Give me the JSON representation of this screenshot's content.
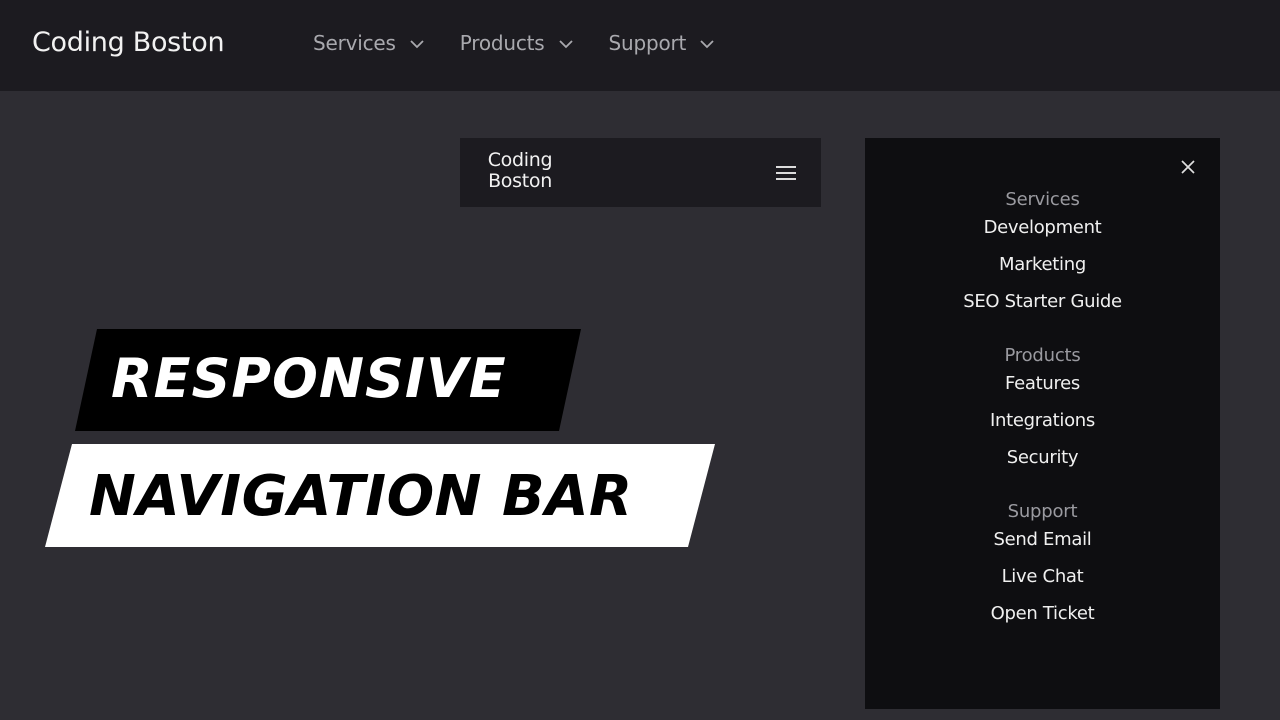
{
  "topbar": {
    "logo": "Coding Boston",
    "menu": [
      {
        "label": "Services",
        "icon": "chevron-down-icon"
      },
      {
        "label": "Products",
        "icon": "chevron-down-icon"
      },
      {
        "label": "Support",
        "icon": "chevron-down-icon"
      }
    ]
  },
  "mobile_bar": {
    "logo_line1": "Coding",
    "logo_line2": "Boston",
    "menu_icon": "hamburger-icon"
  },
  "drawer": {
    "close_icon": "close-icon",
    "sections": [
      {
        "heading": "Services",
        "links": [
          "Development",
          "Marketing",
          "SEO Starter Guide"
        ]
      },
      {
        "heading": "Products",
        "links": [
          "Features",
          "Integrations",
          "Security"
        ]
      },
      {
        "heading": "Support",
        "links": [
          "Send Email",
          "Live Chat",
          "Open Ticket"
        ]
      }
    ]
  },
  "banner": {
    "line1": "RESPONSIVE",
    "line2": "NAVIGATION BAR"
  },
  "colors": {
    "background": "#2e2d33",
    "nav_background": "#1c1b20",
    "drawer_background": "#0e0e11",
    "menu_text": "#a9a9ae",
    "heading_text": "#9a9aa0",
    "link_text": "#f0f0f0",
    "banner_dark": "#000000",
    "banner_light": "#ffffff"
  }
}
